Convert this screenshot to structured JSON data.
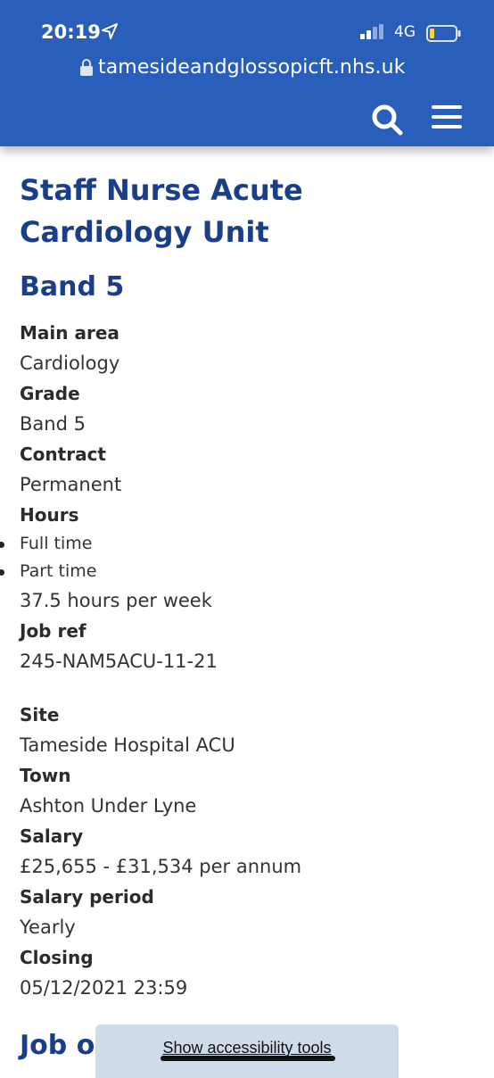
{
  "status_bar": {
    "time": "20:19",
    "network": "4G",
    "icons": [
      "location-arrow-icon",
      "signal-icon",
      "battery-icon"
    ]
  },
  "browser": {
    "url": "tamesideandglossopicft.nhs.uk",
    "icons": [
      "lock-icon",
      "search-icon",
      "menu-icon"
    ]
  },
  "colors": {
    "header_bg": "#2a5ebb",
    "heading": "#1b3e8a",
    "battery_fill": "#f5d547",
    "a11y_bg": "#cfdbe9"
  },
  "job": {
    "title": "Staff Nurse Acute Cardiology Unit",
    "band_heading": "Band 5",
    "main_area_label": "Main area",
    "main_area": "Cardiology",
    "grade_label": "Grade",
    "grade": "Band 5",
    "contract_label": "Contract",
    "contract": "Permanent",
    "hours_label": "Hours",
    "hours_options": [
      "Full time",
      "Part time"
    ],
    "hours_per_week": "37.5 hours per week",
    "job_ref_label": "Job ref",
    "job_ref": "245-NAM5ACU-11-21",
    "site_label": "Site",
    "site": "Tameside Hospital ACU",
    "town_label": "Town",
    "town": "Ashton Under Lyne",
    "salary_label": "Salary",
    "salary": "£25,655 - £31,534 per annum",
    "salary_period_label": "Salary period",
    "salary_period": "Yearly",
    "closing_label": "Closing",
    "closing": "05/12/2021 23:59",
    "next_heading_partial": "Job o"
  },
  "accessibility": {
    "link": "Show accessibility tools"
  }
}
